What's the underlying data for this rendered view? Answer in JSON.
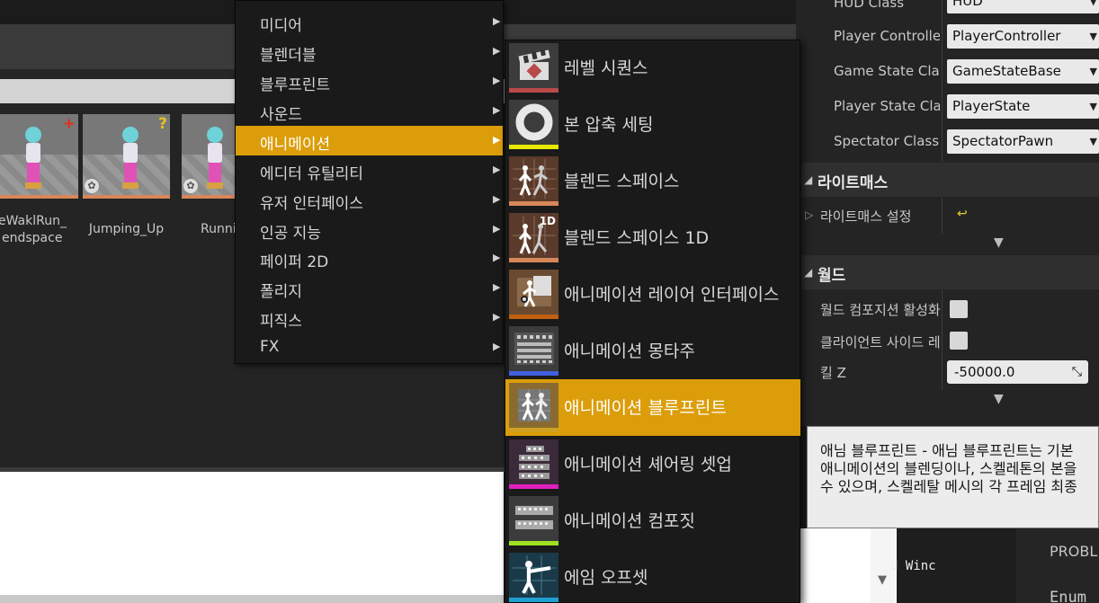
{
  "main_menu": {
    "items": [
      {
        "label": "미디어"
      },
      {
        "label": "블렌더블"
      },
      {
        "label": "블루프린트"
      },
      {
        "label": "사운드"
      },
      {
        "label": "애니메이션"
      },
      {
        "label": "에디터 유틸리티"
      },
      {
        "label": "유저 인터페이스"
      },
      {
        "label": "인공 지능"
      },
      {
        "label": "페이퍼 2D"
      },
      {
        "label": "폴리지"
      },
      {
        "label": "피직스"
      },
      {
        "label": "FX"
      }
    ],
    "active_index": 4,
    "submenu_arrow": "▶"
  },
  "submenu": {
    "items": [
      {
        "label": "레벨 시퀀스",
        "icon": "clapperboard-icon",
        "color": "#b84a4a"
      },
      {
        "label": "본 압축 세팅",
        "icon": "ring-icon",
        "color": "#e8e800"
      },
      {
        "label": "블렌드 스페이스",
        "icon": "blendspace-icon",
        "color": "#d7875a"
      },
      {
        "label": "블렌드 스페이스 1D",
        "icon": "blendspace-1d-icon",
        "color": "#d7875a",
        "badge": "1D"
      },
      {
        "label": "애니메이션 레이어 인터페이스",
        "icon": "anim-layer-interface-icon",
        "color": "#c06010"
      },
      {
        "label": "애니메이션 몽타주",
        "icon": "montage-icon",
        "color": "#4060e0"
      },
      {
        "label": "애니메이션 블루프린트",
        "icon": "anim-blueprint-icon",
        "color": "#d0a020"
      },
      {
        "label": "애니메이션 셰어링 셋업",
        "icon": "sharing-setup-icon",
        "color": "#e020c0"
      },
      {
        "label": "애니메이션 컴포짓",
        "icon": "composite-icon",
        "color": "#a0e020"
      },
      {
        "label": "에임 오프셋",
        "icon": "aim-offset-icon",
        "color": "#20a0d0"
      }
    ],
    "active_index": 6
  },
  "assets": [
    {
      "label_line1": "eWaklRun_",
      "label_line2": "endspace",
      "badge": "+",
      "badge_color": "#e03020"
    },
    {
      "label_line1": "Jumping_Up",
      "label_line2": "",
      "badge": "?",
      "badge_color": "#e8c020"
    },
    {
      "label_line1": "Runni",
      "label_line2": "",
      "badge": "",
      "badge_color": ""
    }
  ],
  "details": {
    "game_mode_rows": [
      {
        "label": "HUD Class",
        "value": "HUD"
      },
      {
        "label": "Player Controller",
        "value": "PlayerController"
      },
      {
        "label": "Game State Clas",
        "value": "GameStateBase"
      },
      {
        "label": "Player State Clas",
        "value": "PlayerState"
      },
      {
        "label": "Spectator Class",
        "value": "SpectatorPawn"
      }
    ],
    "lightmass": {
      "title": "라이트매스",
      "settings_label": "라이트매스 설정",
      "reset_glyph": "↩"
    },
    "world": {
      "title": "월드",
      "rows": [
        {
          "label": "월드 컴포지션 활성화"
        },
        {
          "label": "클라이언트 사이드 레"
        }
      ],
      "kill_z_label": "킬 Z",
      "kill_z_value": "-50000.0"
    }
  },
  "tooltip": {
    "line1": "애님 블루프린트 - 애님 블루프린트는 기본",
    "line2": "애니메이션의 블렌딩이나, 스켈레톤의 본을",
    "line3": "수 있으며, 스켈레탈 메시의 각 프레임 최종"
  },
  "bottom_panel": {
    "problems_label": "PROBL",
    "enum_label": "Enum",
    "code_fragment": "d Winc"
  }
}
